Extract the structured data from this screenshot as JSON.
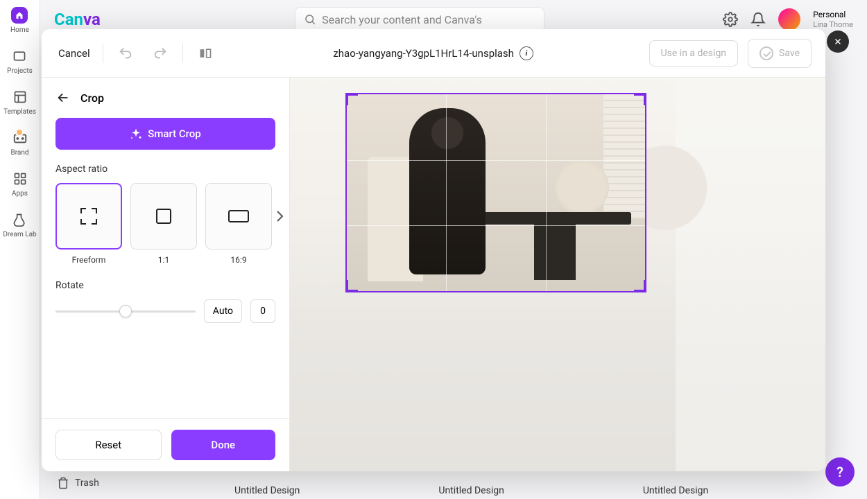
{
  "app": {
    "search_placeholder": "Search your content and Canva's",
    "user_name": "Personal",
    "user_sub": "Lina Thorne"
  },
  "sidebar": {
    "items": [
      {
        "label": "Home"
      },
      {
        "label": "Projects"
      },
      {
        "label": "Templates"
      },
      {
        "label": "Brand"
      },
      {
        "label": "Apps"
      },
      {
        "label": "Dream Lab"
      }
    ]
  },
  "bottom": {
    "trash": "Trash",
    "designs": [
      "Untitled Design",
      "Untitled Design",
      "Untitled Design"
    ]
  },
  "modal": {
    "cancel": "Cancel",
    "filename": "zhao-yangyang-Y3gpL1HrL14-unsplash",
    "use_in_design": "Use in a design",
    "save": "Save"
  },
  "crop": {
    "title": "Crop",
    "smart_crop": "Smart Crop",
    "aspect_label": "Aspect ratio",
    "aspects": [
      {
        "label": "Freeform"
      },
      {
        "label": "1:1"
      },
      {
        "label": "16:9"
      }
    ],
    "rotate_label": "Rotate",
    "auto": "Auto",
    "rotate_value": "0",
    "reset": "Reset",
    "done": "Done"
  }
}
